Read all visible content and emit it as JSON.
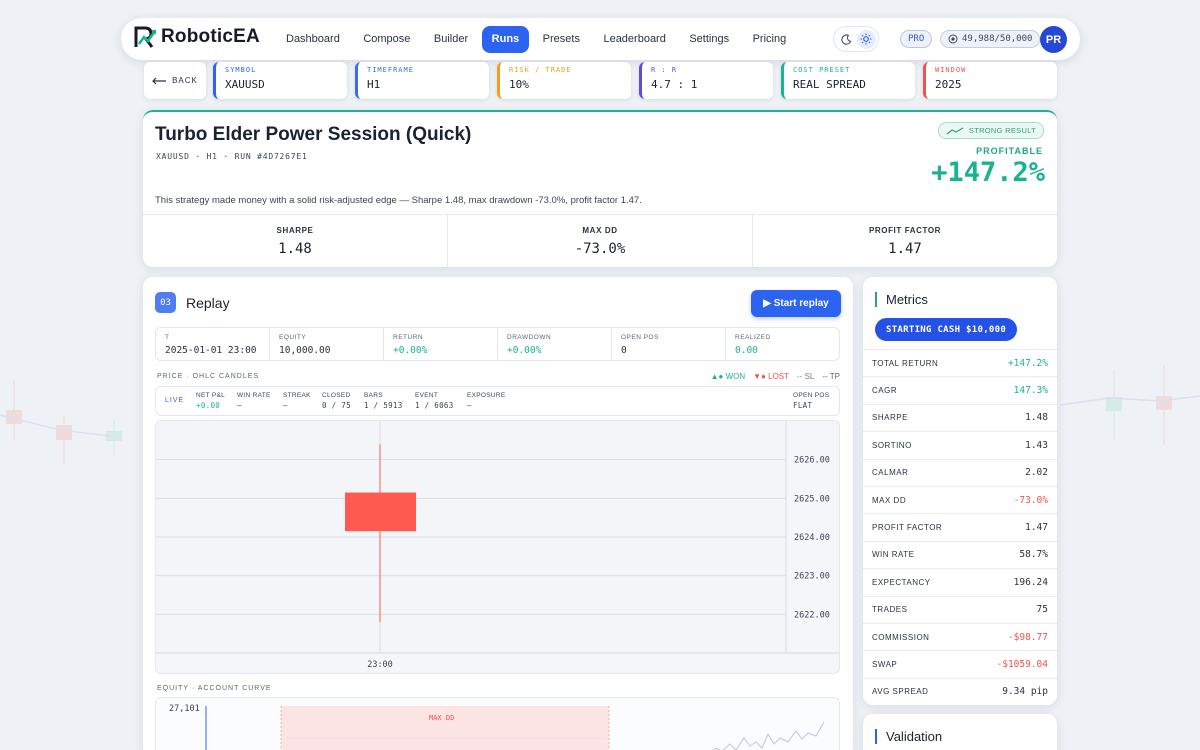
{
  "brand": {
    "name": "RoboticEA"
  },
  "nav": {
    "links": [
      "Dashboard",
      "Compose",
      "Builder",
      "Runs",
      "Presets",
      "Leaderboard",
      "Settings",
      "Pricing"
    ],
    "active": "Runs",
    "plan_badge": "PRO",
    "credits": "49,988/50,000",
    "avatar_initials": "PR"
  },
  "params": {
    "back": "BACK",
    "items": [
      {
        "label": "SYMBOL",
        "value": "XAUUSD",
        "color": "#2c63f0"
      },
      {
        "label": "TIMEFRAME",
        "value": "H1",
        "color": "#3a6fe0"
      },
      {
        "label": "RISK / TRADE",
        "value": "10%",
        "color": "#f0a020"
      },
      {
        "label": "R : R",
        "value": "4.7 : 1",
        "color": "#5c4fd6"
      },
      {
        "label": "COST PRESET",
        "value": "REAL SPREAD",
        "color": "#19b38f"
      },
      {
        "label": "WINDOW",
        "value": "2025",
        "color": "#ef5350"
      }
    ]
  },
  "summary": {
    "title": "Turbo Elder Power Session (Quick)",
    "subtitle": "XAUUSD · H1 · RUN #4D7267E1",
    "description": "This strategy made money with a solid risk-adjusted edge — Sharpe 1.48, max drawdown -73.0%, profit factor 1.47.",
    "badge": "STRONG RESULT",
    "profit_label": "PROFITABLE",
    "profit_value": "+147.2%",
    "kpis": [
      {
        "label": "SHARPE",
        "value": "1.48"
      },
      {
        "label": "MAX DD",
        "value": "-73.0%"
      },
      {
        "label": "PROFIT FACTOR",
        "value": "1.47"
      }
    ]
  },
  "replay": {
    "section_number": "03",
    "title": "Replay",
    "start_button": "▶ Start replay",
    "stats": [
      {
        "label": "T",
        "value": "2025-01-01 23:00"
      },
      {
        "label": "EQUITY",
        "value": "10,000.00"
      },
      {
        "label": "RETURN",
        "value": "+0.00%"
      },
      {
        "label": "DRAWDOWN",
        "value": "+0.00%"
      },
      {
        "label": "OPEN POS",
        "value": "0"
      },
      {
        "label": "REALIZED",
        "value": "0.00"
      }
    ],
    "price_label": "PRICE · OHLC CANDLES",
    "legend": {
      "won": "▲● WON",
      "lost": "▼● LOST",
      "sl": "-- SL",
      "tp": "-- TP"
    },
    "live": {
      "live_label": "LIVE",
      "net_pnl_label": "NET P&L",
      "net_pnl": "+0.00",
      "win_rate_label": "WIN RATE",
      "win_rate": "—",
      "streak_label": "STREAK",
      "streak": "—",
      "closed_label": "CLOSED",
      "closed": "0 / 75",
      "bars_label": "BARS",
      "bars": "1 / 5913",
      "event_label": "EVENT",
      "event": "1 / 6063",
      "exposure_label": "EXPOSURE",
      "exposure": "—",
      "open_pos_label": "OPEN POS",
      "open_pos": "FLAT"
    },
    "equity_label": "EQUITY · ACCOUNT CURVE",
    "equity_top": "27,101",
    "max_dd_label": "MAX DD",
    "colors": {
      "down": "#ff5a4f",
      "up": "#19b38f"
    }
  },
  "chart_data": {
    "type": "candlestick",
    "x_ticks": [
      "23:00"
    ],
    "y_ticks": [
      "2626.00",
      "2625.00",
      "2624.00",
      "2623.00",
      "2622.00"
    ],
    "ylim": [
      2621.0,
      2627.0
    ],
    "candles": [
      {
        "t": "23:00",
        "open": 2625.15,
        "high": 2626.4,
        "low": 2621.8,
        "close": 2624.15
      }
    ]
  },
  "metrics": {
    "title": "Metrics",
    "starting_cash": "STARTING CASH $10,000",
    "rows": [
      {
        "label": "TOTAL RETURN",
        "value": "+147.2%",
        "tone": "pos"
      },
      {
        "label": "CAGR",
        "value": "147.3%",
        "tone": "pos"
      },
      {
        "label": "SHARPE",
        "value": "1.48",
        "tone": ""
      },
      {
        "label": "SORTINO",
        "value": "1.43",
        "tone": ""
      },
      {
        "label": "CALMAR",
        "value": "2.02",
        "tone": ""
      },
      {
        "label": "MAX DD",
        "value": "-73.0%",
        "tone": "neg"
      },
      {
        "label": "PROFIT FACTOR",
        "value": "1.47",
        "tone": ""
      },
      {
        "label": "WIN RATE",
        "value": "58.7%",
        "tone": ""
      },
      {
        "label": "EXPECTANCY",
        "value": "196.24",
        "tone": ""
      },
      {
        "label": "TRADES",
        "value": "75",
        "tone": ""
      },
      {
        "label": "COMMISSION",
        "value": "-$98.77",
        "tone": "neg"
      },
      {
        "label": "SWAP",
        "value": "-$1059.04",
        "tone": "neg"
      },
      {
        "label": "AVG SPREAD",
        "value": "9.34 pip",
        "tone": ""
      }
    ]
  },
  "validation": {
    "title": "Validation"
  }
}
